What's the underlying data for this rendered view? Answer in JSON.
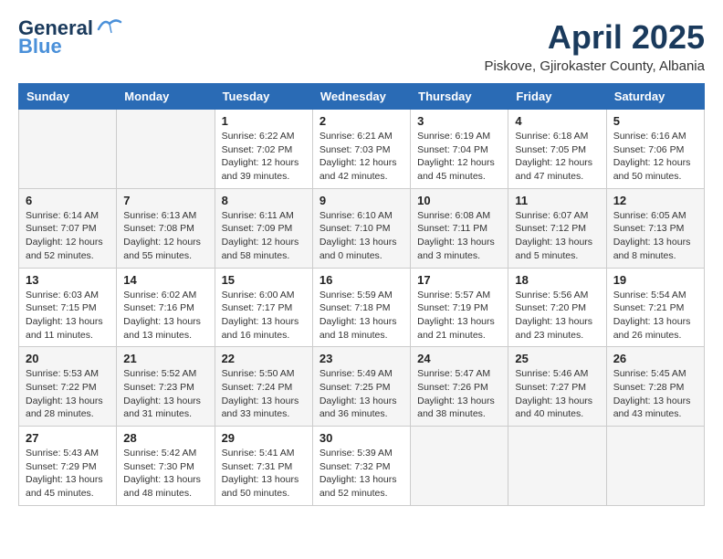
{
  "header": {
    "logo_general": "General",
    "logo_blue": "Blue",
    "month_title": "April 2025",
    "location": "Piskove, Gjirokaster County, Albania"
  },
  "days_of_week": [
    "Sunday",
    "Monday",
    "Tuesday",
    "Wednesday",
    "Thursday",
    "Friday",
    "Saturday"
  ],
  "weeks": [
    [
      {
        "day": "",
        "info": ""
      },
      {
        "day": "",
        "info": ""
      },
      {
        "day": "1",
        "info": "Sunrise: 6:22 AM\nSunset: 7:02 PM\nDaylight: 12 hours and 39 minutes."
      },
      {
        "day": "2",
        "info": "Sunrise: 6:21 AM\nSunset: 7:03 PM\nDaylight: 12 hours and 42 minutes."
      },
      {
        "day": "3",
        "info": "Sunrise: 6:19 AM\nSunset: 7:04 PM\nDaylight: 12 hours and 45 minutes."
      },
      {
        "day": "4",
        "info": "Sunrise: 6:18 AM\nSunset: 7:05 PM\nDaylight: 12 hours and 47 minutes."
      },
      {
        "day": "5",
        "info": "Sunrise: 6:16 AM\nSunset: 7:06 PM\nDaylight: 12 hours and 50 minutes."
      }
    ],
    [
      {
        "day": "6",
        "info": "Sunrise: 6:14 AM\nSunset: 7:07 PM\nDaylight: 12 hours and 52 minutes."
      },
      {
        "day": "7",
        "info": "Sunrise: 6:13 AM\nSunset: 7:08 PM\nDaylight: 12 hours and 55 minutes."
      },
      {
        "day": "8",
        "info": "Sunrise: 6:11 AM\nSunset: 7:09 PM\nDaylight: 12 hours and 58 minutes."
      },
      {
        "day": "9",
        "info": "Sunrise: 6:10 AM\nSunset: 7:10 PM\nDaylight: 13 hours and 0 minutes."
      },
      {
        "day": "10",
        "info": "Sunrise: 6:08 AM\nSunset: 7:11 PM\nDaylight: 13 hours and 3 minutes."
      },
      {
        "day": "11",
        "info": "Sunrise: 6:07 AM\nSunset: 7:12 PM\nDaylight: 13 hours and 5 minutes."
      },
      {
        "day": "12",
        "info": "Sunrise: 6:05 AM\nSunset: 7:13 PM\nDaylight: 13 hours and 8 minutes."
      }
    ],
    [
      {
        "day": "13",
        "info": "Sunrise: 6:03 AM\nSunset: 7:15 PM\nDaylight: 13 hours and 11 minutes."
      },
      {
        "day": "14",
        "info": "Sunrise: 6:02 AM\nSunset: 7:16 PM\nDaylight: 13 hours and 13 minutes."
      },
      {
        "day": "15",
        "info": "Sunrise: 6:00 AM\nSunset: 7:17 PM\nDaylight: 13 hours and 16 minutes."
      },
      {
        "day": "16",
        "info": "Sunrise: 5:59 AM\nSunset: 7:18 PM\nDaylight: 13 hours and 18 minutes."
      },
      {
        "day": "17",
        "info": "Sunrise: 5:57 AM\nSunset: 7:19 PM\nDaylight: 13 hours and 21 minutes."
      },
      {
        "day": "18",
        "info": "Sunrise: 5:56 AM\nSunset: 7:20 PM\nDaylight: 13 hours and 23 minutes."
      },
      {
        "day": "19",
        "info": "Sunrise: 5:54 AM\nSunset: 7:21 PM\nDaylight: 13 hours and 26 minutes."
      }
    ],
    [
      {
        "day": "20",
        "info": "Sunrise: 5:53 AM\nSunset: 7:22 PM\nDaylight: 13 hours and 28 minutes."
      },
      {
        "day": "21",
        "info": "Sunrise: 5:52 AM\nSunset: 7:23 PM\nDaylight: 13 hours and 31 minutes."
      },
      {
        "day": "22",
        "info": "Sunrise: 5:50 AM\nSunset: 7:24 PM\nDaylight: 13 hours and 33 minutes."
      },
      {
        "day": "23",
        "info": "Sunrise: 5:49 AM\nSunset: 7:25 PM\nDaylight: 13 hours and 36 minutes."
      },
      {
        "day": "24",
        "info": "Sunrise: 5:47 AM\nSunset: 7:26 PM\nDaylight: 13 hours and 38 minutes."
      },
      {
        "day": "25",
        "info": "Sunrise: 5:46 AM\nSunset: 7:27 PM\nDaylight: 13 hours and 40 minutes."
      },
      {
        "day": "26",
        "info": "Sunrise: 5:45 AM\nSunset: 7:28 PM\nDaylight: 13 hours and 43 minutes."
      }
    ],
    [
      {
        "day": "27",
        "info": "Sunrise: 5:43 AM\nSunset: 7:29 PM\nDaylight: 13 hours and 45 minutes."
      },
      {
        "day": "28",
        "info": "Sunrise: 5:42 AM\nSunset: 7:30 PM\nDaylight: 13 hours and 48 minutes."
      },
      {
        "day": "29",
        "info": "Sunrise: 5:41 AM\nSunset: 7:31 PM\nDaylight: 13 hours and 50 minutes."
      },
      {
        "day": "30",
        "info": "Sunrise: 5:39 AM\nSunset: 7:32 PM\nDaylight: 13 hours and 52 minutes."
      },
      {
        "day": "",
        "info": ""
      },
      {
        "day": "",
        "info": ""
      },
      {
        "day": "",
        "info": ""
      }
    ]
  ]
}
